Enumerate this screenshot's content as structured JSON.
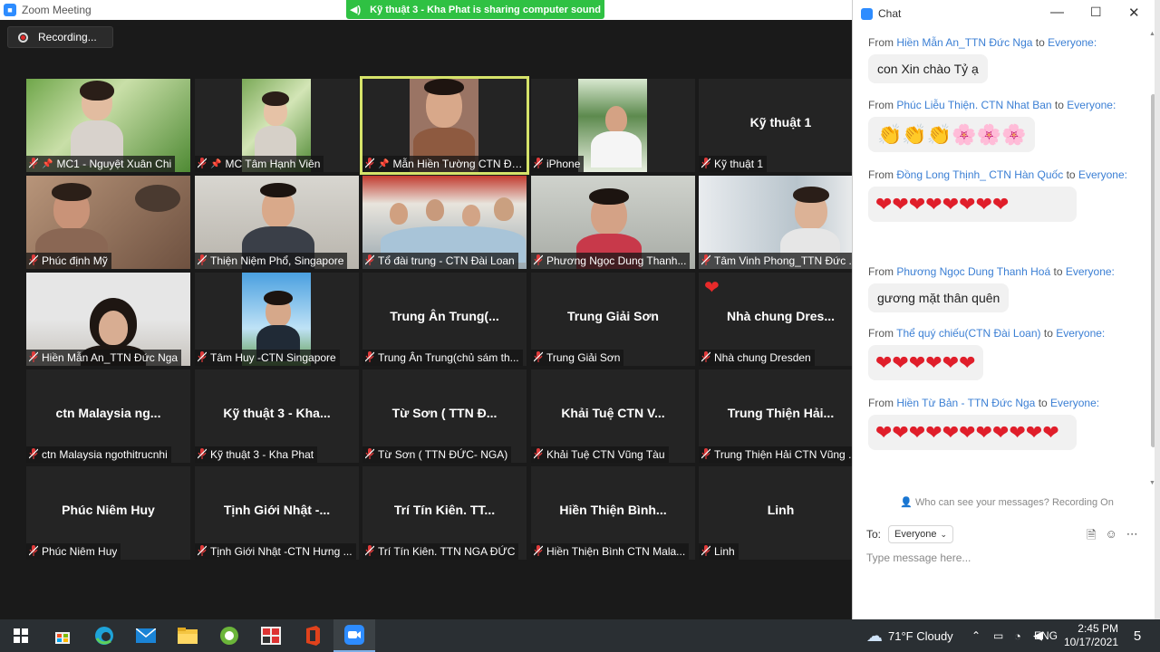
{
  "window": {
    "title": "Zoom Meeting"
  },
  "share_banner": "Kỹ thuật 3 - Kha Phat is sharing computer sound",
  "recording": {
    "label": "Recording..."
  },
  "tiles": [
    {
      "name": "MC1 - Nguyệt Xuân Chi",
      "big": "",
      "video": "lotus",
      "pinned": true
    },
    {
      "name": "MC Tâm Hạnh Viên",
      "big": "",
      "video": "lotus2",
      "pinned": true
    },
    {
      "name": "Mẫn Hiền Tường CTN Đài ...",
      "big": "",
      "video": "face",
      "pinned": true,
      "active": true
    },
    {
      "name": "iPhone",
      "big": "",
      "video": "man"
    },
    {
      "name": "Kỹ thuật 1",
      "big": "Kỹ thuật 1",
      "video": ""
    },
    {
      "name": "Phúc định Mỹ",
      "big": "",
      "video": "room"
    },
    {
      "name": "Thiện Niệm Phổ, Singapore",
      "big": "",
      "video": "room2"
    },
    {
      "name": "Tổ đài trung - CTN Đài Loan",
      "big": "",
      "video": "group"
    },
    {
      "name": "Phương Ngọc Dung Thanh...",
      "big": "",
      "video": "room3"
    },
    {
      "name": "Tâm Vinh Phong_TTN Đức ...",
      "big": "",
      "video": "room4"
    },
    {
      "name": "Hiền Mẫn An_TTN Đức Nga",
      "big": "",
      "video": "girl"
    },
    {
      "name": "Tâm Huy -CTN Singapore",
      "big": "",
      "video": "sky"
    },
    {
      "name": "Trung Ân Trung(chủ sám th...",
      "big": "Trung Ân Trung(...",
      "video": ""
    },
    {
      "name": "Trung Giải Sơn",
      "big": "Trung Giải Sơn",
      "video": ""
    },
    {
      "name": "Nhà chung Dresden",
      "big": "Nhà chung Dres...",
      "video": "",
      "heart": "❤"
    },
    {
      "name": "ctn Malaysia ngothitrucnhi",
      "big": "ctn Malaysia ng...",
      "video": ""
    },
    {
      "name": "Kỹ thuật 3 - Kha Phat",
      "big": "Kỹ thuật 3 - Kha...",
      "video": ""
    },
    {
      "name": "Từ Sơn ( TTN ĐỨC- NGA)",
      "big": "Từ Sơn ( TTN Đ...",
      "video": ""
    },
    {
      "name": "Khải Tuệ CTN Vũng Tàu",
      "big": "Khải Tuệ CTN V...",
      "video": ""
    },
    {
      "name": "Trung Thiện Hải CTN Vũng ...",
      "big": "Trung Thiện Hải...",
      "video": ""
    },
    {
      "name": "Phúc Niêm Huy",
      "big": "Phúc Niêm Huy",
      "video": ""
    },
    {
      "name": "Tịnh Giới Nhật -CTN Hưng ...",
      "big": "Tịnh Giới Nhật -...",
      "video": ""
    },
    {
      "name": "Trí Tín Kiên. TTN NGA ĐỨC",
      "big": "Trí Tín Kiên. TT...",
      "video": ""
    },
    {
      "name": "Hiền Thiện Bình CTN Mala...",
      "big": "Hiền Thiện Bình...",
      "video": ""
    },
    {
      "name": "Linh",
      "big": "Linh",
      "video": ""
    }
  ],
  "chat": {
    "title": "Chat",
    "messages": [
      {
        "from_prefix": "From",
        "sender": "Hiền Mẫn An_TTN Đức Nga",
        "to_word": "to",
        "recipient": "Everyone:",
        "text": "con Xin chào Tỷ ạ"
      },
      {
        "from_prefix": "From",
        "sender": "Phúc Liễu Thiện. CTN Nhat Ban",
        "to_word": "to",
        "recipient": "Everyone:",
        "text": "👏👏👏🌸🌸🌸"
      },
      {
        "from_prefix": "From",
        "sender": "Đồng Long Thịnh_ CTN Hàn Quốc",
        "to_word": "to",
        "recipient": "Everyone:",
        "text": "❤❤❤❤❤❤❤❤"
      },
      {
        "from_prefix": "From",
        "sender": "Phương Ngọc Dung Thanh Hoá",
        "to_word": "to",
        "recipient": "Everyone:",
        "text": "gương mặt thân quên"
      },
      {
        "from_prefix": "From",
        "sender": "Thể quý chiếu(CTN Đài Loan)",
        "to_word": "to",
        "recipient": "Everyone:",
        "text": "❤❤❤❤❤❤"
      },
      {
        "from_prefix": "From",
        "sender": "Hiền Từ Bản - TTN Đức Nga",
        "to_word": "to",
        "recipient": "Everyone:",
        "text": "❤❤❤❤❤❤❤❤❤❤❤"
      }
    ],
    "privacy_note": "Who can see your messages? Recording On",
    "to_label": "To:",
    "to_value": "Everyone",
    "input_placeholder": "Type message here..."
  },
  "taskbar": {
    "weather": "71°F Cloudy",
    "lang": "ENG",
    "time": "2:45 PM",
    "date": "10/17/2021",
    "notifications": "5"
  },
  "colors": {
    "accent": "#2d8cff",
    "active_speaker": "#d6e36a",
    "share_banner": "#2fc143",
    "muted": "#e03a3a",
    "link": "#3b7fd4"
  }
}
